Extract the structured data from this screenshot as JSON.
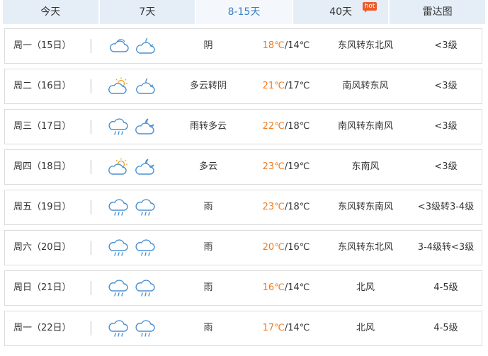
{
  "tabs": [
    {
      "label": "今天",
      "active": false
    },
    {
      "label": "7天",
      "active": false
    },
    {
      "label": "8-15天",
      "active": true
    },
    {
      "label": "40天",
      "active": false,
      "badge": "hot"
    },
    {
      "label": "雷达图",
      "active": false
    }
  ],
  "accent_colors": {
    "tab_active_text": "#3d7fc6",
    "high_temp": "#f37b1d",
    "badge": "#f05a28",
    "icon_stroke": "#4a8fd1"
  },
  "days": [
    {
      "date": "周一（15日）",
      "icons": [
        "cloudy-icon",
        "cloudy-night-icon"
      ],
      "condition": "阴",
      "high": "18℃",
      "low": "/14℃",
      "wind": "东风转东北风",
      "level": "<3级"
    },
    {
      "date": "周二（16日）",
      "icons": [
        "partly-cloudy-icon",
        "cloudy-night-icon"
      ],
      "condition": "多云转阴",
      "high": "21℃",
      "low": "/17℃",
      "wind": "南风转东风",
      "level": "<3级"
    },
    {
      "date": "周三（17日）",
      "icons": [
        "rain-icon",
        "partly-cloudy-night-icon"
      ],
      "condition": "雨转多云",
      "high": "22℃",
      "low": "/18℃",
      "wind": "南风转东南风",
      "level": "<3级"
    },
    {
      "date": "周四（18日）",
      "icons": [
        "partly-cloudy-icon",
        "partly-cloudy-night-icon"
      ],
      "condition": "多云",
      "high": "23℃",
      "low": "/19℃",
      "wind": "东南风",
      "level": "<3级"
    },
    {
      "date": "周五（19日）",
      "icons": [
        "rain-icon",
        "rain-icon"
      ],
      "condition": "雨",
      "high": "23℃",
      "low": "/18℃",
      "wind": "东风转东南风",
      "level": "<3级转3-4级"
    },
    {
      "date": "周六（20日）",
      "icons": [
        "rain-icon",
        "rain-icon"
      ],
      "condition": "雨",
      "high": "20℃",
      "low": "/16℃",
      "wind": "东风转东北风",
      "level": "3-4级转<3级"
    },
    {
      "date": "周日（21日）",
      "icons": [
        "rain-icon",
        "rain-icon"
      ],
      "condition": "雨",
      "high": "16℃",
      "low": "/14℃",
      "wind": "北风",
      "level": "4-5级"
    },
    {
      "date": "周一（22日）",
      "icons": [
        "rain-icon",
        "rain-icon"
      ],
      "condition": "雨",
      "high": "17℃",
      "low": "/14℃",
      "wind": "北风",
      "level": "4-5级"
    }
  ]
}
